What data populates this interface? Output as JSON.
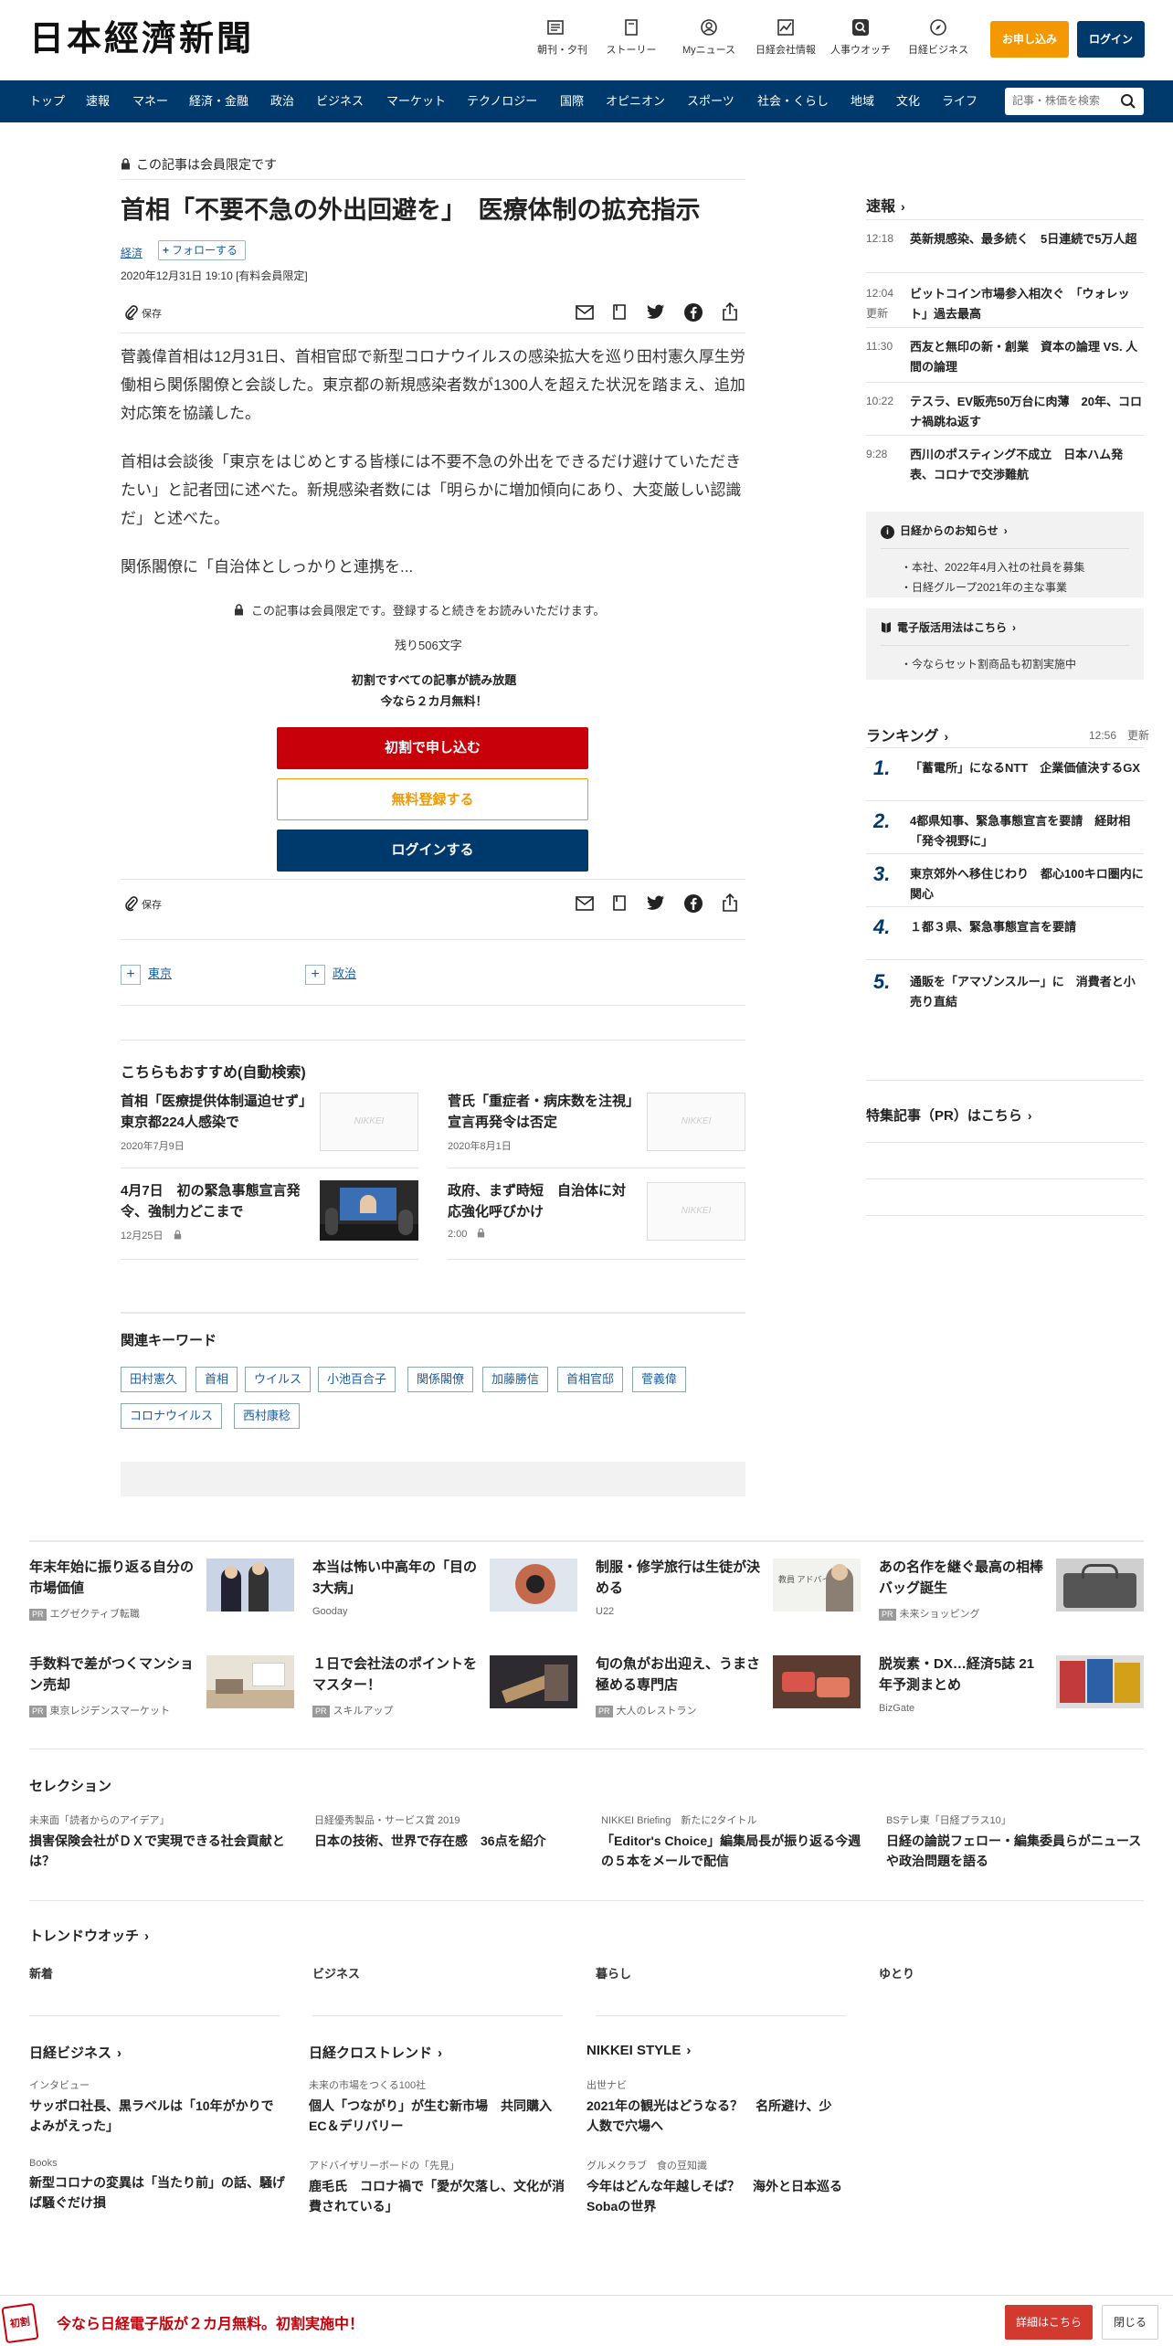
{
  "header": {
    "logo": "日本經濟新聞",
    "nav": [
      {
        "label": "朝刊・夕刊",
        "icon": "newspaper-icon"
      },
      {
        "label": "ストーリー",
        "icon": "story-icon"
      },
      {
        "label": "Myニュース",
        "icon": "user-icon"
      },
      {
        "label": "日経会社情報",
        "icon": "chart-icon"
      },
      {
        "label": "人事ウオッチ",
        "icon": "search-icon"
      },
      {
        "label": "日経ビジネス",
        "icon": "compass-icon"
      }
    ],
    "apply": "お申し込み",
    "login": "ログイン"
  },
  "menu": {
    "items": [
      "トップ",
      "速報",
      "マネー",
      "経済・金融",
      "政治",
      "ビジネス",
      "マーケット",
      "テクノロジー",
      "国際",
      "オピニオン",
      "スポーツ",
      "社会・くらし",
      "地域",
      "文化",
      "ライフ"
    ],
    "search_placeholder": "記事・株価を検索"
  },
  "article": {
    "members_only": "この記事は会員限定です",
    "title": "首相「不要不急の外出回避を」　医療体制の拡充指示",
    "category": "経済",
    "follow": "フォローする",
    "date": "2020年12月31日 19:10 [有料会員限定]",
    "save": "保存",
    "paragraphs": [
      "菅義偉首相は12月31日、首相官邸で新型コロナウイルスの感染拡大を巡り田村憲久厚生労働相ら関係閣僚と会談した。東京都の新規感染者数が1300人を超えた状況を踏まえ、追加対応策を協議した。",
      "首相は会談後「東京をはじめとする皆様には不要不急の外出をできるだけ避けていただきたい」と記者団に述べた。新規感染者数には「明らかに増加傾向にあり、大変厳しい認識だ」と述べた。",
      "関係閣僚に「自治体としっかりと連携を..."
    ],
    "lock_note": "この記事は会員限定です。登録すると続きをお読みいただけます。",
    "remaining": "残り506文字",
    "promo_line1": "初割ですべての記事が読み放題",
    "promo_line2": "今なら２カ月無料！",
    "cta_primary": "初割で申し込む",
    "cta_free": "無料登録する",
    "cta_login": "ログインする",
    "tags": [
      "東京",
      "政治"
    ]
  },
  "recommend": {
    "heading": "こちらもおすすめ(自動検索)",
    "items": [
      {
        "title": "首相「医療提供体制逼迫せず」　東京都224人感染で",
        "date": "2020年7月9日",
        "thumb": "NIKKEI"
      },
      {
        "title": "菅氏「重症者・病床数を注視」　宣言再発令は否定",
        "date": "2020年8月1日",
        "thumb": "NIKKEI"
      },
      {
        "title": "4月7日　初の緊急事態宣言発令、強制力どこまで",
        "date": "12月25日",
        "thumb": ""
      },
      {
        "title": "政府、まず時短　自治体に対応強化呼びかけ",
        "date": "2:00",
        "thumb": "NIKKEI"
      }
    ]
  },
  "keywords": {
    "heading": "関連キーワード",
    "items": [
      "田村憲久",
      "首相",
      "ウイルス",
      "小池百合子",
      "関係閣僚",
      "加藤勝信",
      "首相官邸",
      "菅義偉",
      "コロナウイルス",
      "西村康稔"
    ]
  },
  "sidebar": {
    "breaking_heading": "速報",
    "breaking": [
      {
        "time": "12:18",
        "title": "英新規感染、最多続く　5日連続で5万人超",
        "updated": ""
      },
      {
        "time": "12:04",
        "title": "ビットコイン市場参入相次ぐ　「ウォレット」過去最高",
        "updated": "更新"
      },
      {
        "time": "11:30",
        "title": "西友と無印の新・創業　資本の論理 VS. 人間の論理",
        "updated": ""
      },
      {
        "time": "10:22",
        "title": "テスラ、EV販売50万台に肉薄　20年、コロナ禍跳ね返す",
        "updated": ""
      },
      {
        "time": "9:28",
        "title": "西川のポスティング不成立　日本ハム発表、コロナで交渉難航",
        "updated": ""
      }
    ],
    "notice_heading": "日経からのお知らせ",
    "notices": [
      "本社、2022年4月入社の社員を募集",
      "日経グループ2021年の主な事業"
    ],
    "digital_heading": "電子版活用法はこちら",
    "digital": [
      "今ならセット割商品も初割実施中"
    ],
    "ranking_heading": "ランキング",
    "ranking_time": "12:56",
    "ranking_updated": "更新",
    "ranking": [
      {
        "n": "1.",
        "title": "「蓄電所」になるNTT　企業価値決するGX"
      },
      {
        "n": "2.",
        "title": "4都県知事、緊急事態宣言を要請　経財相「発令視野に」"
      },
      {
        "n": "3.",
        "title": "東京郊外へ移住じわり　都心100キロ圏内に関心"
      },
      {
        "n": "4.",
        "title": "１都３県、緊急事態宣言を要請"
      },
      {
        "n": "5.",
        "title": "通販を「アマゾンスルー」に　消費者と小売り直結"
      }
    ],
    "pr_heading": "特集記事（PR）はこちら"
  },
  "ads": [
    {
      "title": "年末年始に振り返る自分の市場価値",
      "src": "エグゼクティブ転職",
      "pr": true
    },
    {
      "title": "本当は怖い中高年の「目の3大病」",
      "src": "Gooday",
      "pr": false
    },
    {
      "title": "制服・修学旅行は生徒が決める",
      "src": "U22",
      "pr": false
    },
    {
      "title": "あの名作を継ぐ最高の相棒バッグ誕生",
      "src": "未来ショッピング",
      "pr": true
    },
    {
      "title": "手数料で差がつくマンション売却",
      "src": "東京レジデンスマーケット",
      "pr": true
    },
    {
      "title": "１日で会社法のポイントをマスター！",
      "src": "スキルアップ",
      "pr": true
    },
    {
      "title": "旬の魚がお出迎え、うまさ極める専門店",
      "src": "大人のレストラン",
      "pr": true
    },
    {
      "title": "脱炭素・DX…経済5誌 21年予測まとめ",
      "src": "BizGate",
      "pr": false
    }
  ],
  "ad_thumb_text": "教員 アドバイス",
  "selection": {
    "heading": "セレクション",
    "items": [
      {
        "sub": "未来面「読者からのアイデア」",
        "title": "損害保険会社がＤＸで実現できる社会貢献とは？"
      },
      {
        "sub": "日経優秀製品・サービス賞 2019",
        "title": "日本の技術、世界で存在感　36点を紹介"
      },
      {
        "sub": "NIKKEI Briefing　新たに2タイトル",
        "title": "「Editor's Choice」編集局長が振り返る今週の５本をメールで配信"
      },
      {
        "sub": "BSテレ東「日経プラス10」",
        "title": "日経の論説フェロー・編集委員らがニュースや政治問題を語る"
      }
    ]
  },
  "trend": {
    "heading": "トレンドウオッチ",
    "cols": [
      "新着",
      "ビジネス",
      "暮らし",
      "ゆとり"
    ]
  },
  "partners": [
    {
      "heading": "日経ビジネス",
      "items": [
        {
          "sub": "インタビュー",
          "title": "サッポロ社長、黒ラベルは「10年がかりでよみがえった」"
        },
        {
          "sub": "Books",
          "title": "新型コロナの変異は「当たり前」の話、騒げば騒ぐだけ損"
        }
      ]
    },
    {
      "heading": "日経クロストレンド",
      "items": [
        {
          "sub": "未来の市場をつくる100社",
          "title": "個人「つながり」が生む新市場　共同購入EC＆デリバリー"
        },
        {
          "sub": "アドバイザリーボードの「先見」",
          "title": "鹿毛氏　コロナ禍で「愛が欠落し、文化が消費されている」"
        }
      ]
    },
    {
      "heading": "NIKKEI STYLE",
      "items": [
        {
          "sub": "出世ナビ",
          "title": "2021年の観光はどうなる？　名所避け、少人数で穴場へ"
        },
        {
          "sub": "グルメクラブ　食の豆知識",
          "title": "今年はどんな年越しそば？　海外と日本巡るSobaの世界"
        }
      ]
    }
  ],
  "bottombar": {
    "badge": "初割",
    "text": "今なら日経電子版が２カ月無料。初割実施中！",
    "detail": "詳細はこちら",
    "close": "閉じる"
  },
  "colors": {
    "navy": "#003a6c",
    "orange": "#f39800",
    "red": "#c8000a",
    "link": "#1a5ea8"
  }
}
